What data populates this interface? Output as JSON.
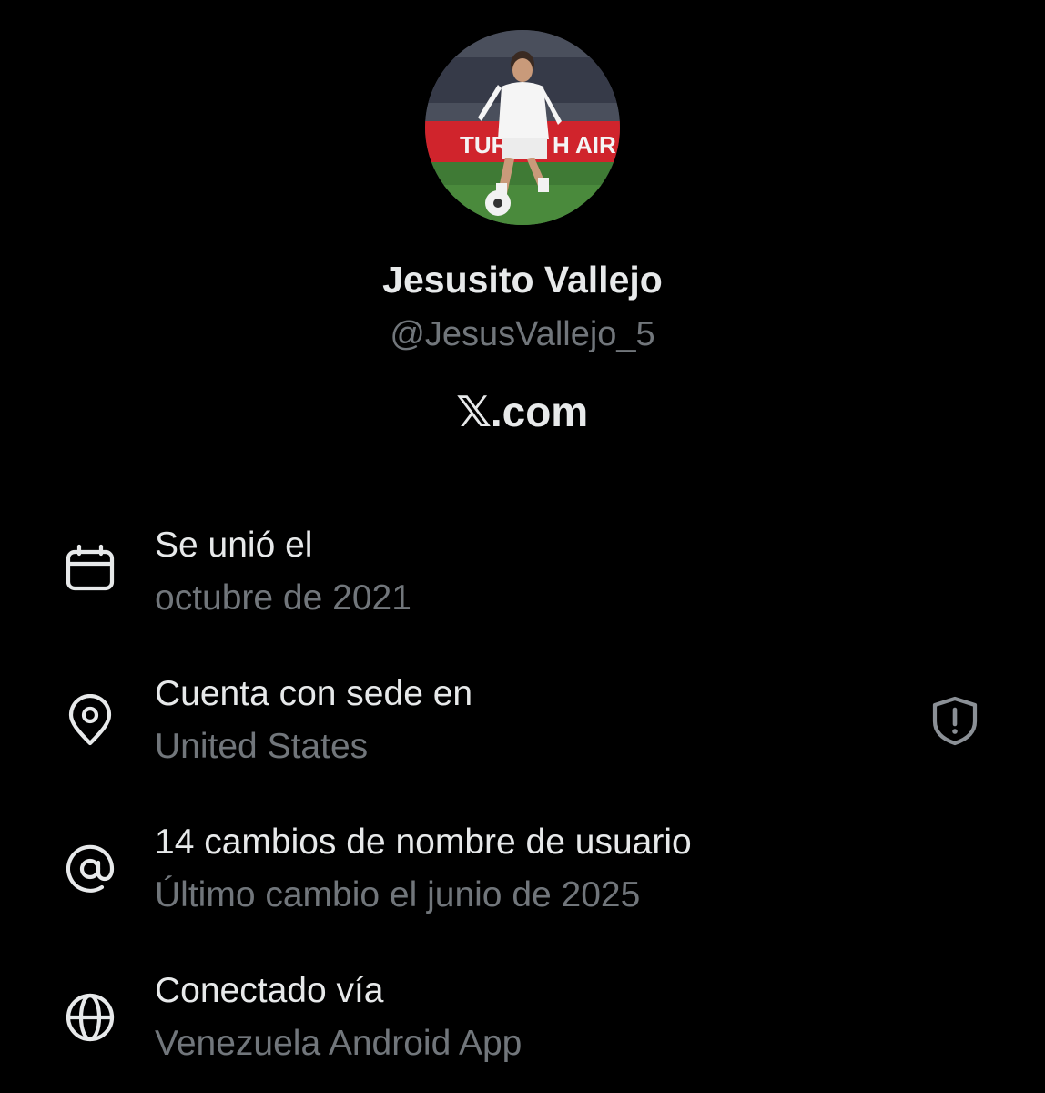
{
  "profile": {
    "display_name": "Jesusito Vallejo",
    "handle": "@JesusVallejo_5",
    "brand_x": "𝕏",
    "brand_suffix": ".com"
  },
  "details": [
    {
      "icon": "calendar-icon",
      "title": "Se unió el",
      "subtitle": "octubre de 2021"
    },
    {
      "icon": "location-pin-icon",
      "title": "Cuenta con sede en",
      "subtitle": "United States",
      "trailing_icon": "shield-alert-icon"
    },
    {
      "icon": "at-sign-icon",
      "title": "14 cambios de nombre de usuario",
      "subtitle": "Último cambio el junio de 2025"
    },
    {
      "icon": "globe-icon",
      "title": "Conectado vía",
      "subtitle": "Venezuela Android App"
    }
  ],
  "colors": {
    "background": "#000000",
    "primary_text": "#e7e9ea",
    "secondary_text": "#71767b"
  }
}
